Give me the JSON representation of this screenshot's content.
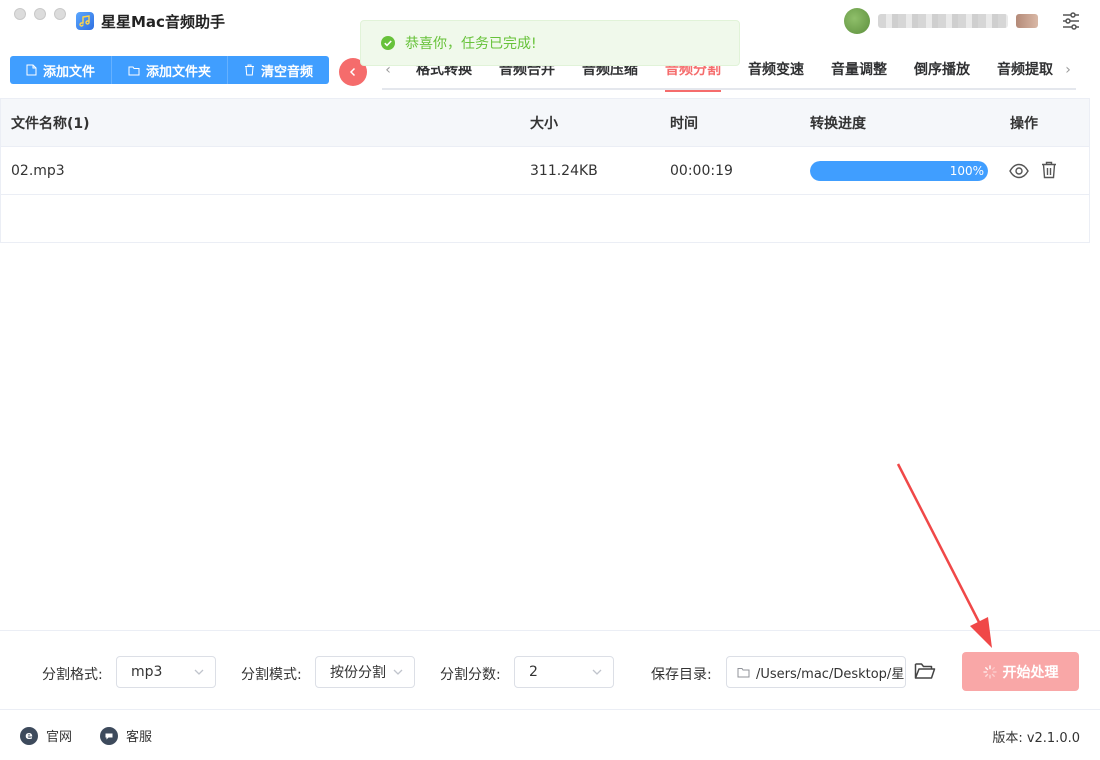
{
  "app": {
    "title": "星星Mac音频助手"
  },
  "toast": {
    "message": "恭喜你，任务已完成!",
    "color": "#67c23a"
  },
  "toolbar": {
    "add_file": "添加文件",
    "add_folder": "添加文件夹",
    "clear_audio": "清空音频"
  },
  "tabs": [
    {
      "label": "格式转换"
    },
    {
      "label": "音频合并"
    },
    {
      "label": "音频压缩"
    },
    {
      "label": "音频分割"
    },
    {
      "label": "音频变速"
    },
    {
      "label": "音量调整"
    },
    {
      "label": "倒序播放"
    },
    {
      "label": "音频提取"
    }
  ],
  "active_tab": "音频分割",
  "table": {
    "headers": {
      "name": "文件名称(1)",
      "size": "大小",
      "time": "时间",
      "progress": "转换进度",
      "ops": "操作"
    },
    "rows": [
      {
        "name": "02.mp3",
        "size": "311.24KB",
        "time": "00:00:19",
        "progress": 100,
        "progress_label": "100%"
      }
    ]
  },
  "settings": {
    "format_label": "分割格式:",
    "format_value": "mp3",
    "mode_label": "分割模式:",
    "mode_value": "按份分割",
    "count_label": "分割分数:",
    "count_value": "2",
    "save_label": "保存目录:",
    "save_path": "/Users/mac/Desktop/星",
    "start_button": "开始处理"
  },
  "footer": {
    "website": "官网",
    "support": "客服",
    "version": "版本: v2.1.0.0"
  },
  "colors": {
    "primary": "#409eff",
    "accent": "#f56c6c",
    "start_button": "#f9a7a7"
  }
}
